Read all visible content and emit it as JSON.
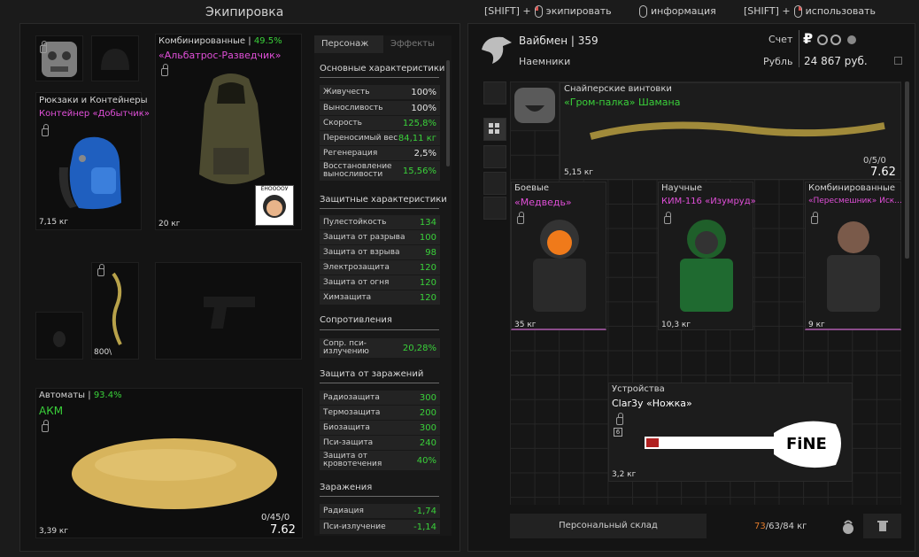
{
  "window": {
    "title": "Экипировка"
  },
  "hints": [
    {
      "prefix": "[SHIFT] +",
      "mouse": "left",
      "label": "экипировать"
    },
    {
      "prefix": "",
      "mouse": "none",
      "label": "информация"
    },
    {
      "prefix": "[SHIFT] +",
      "mouse": "right",
      "label": "использовать"
    }
  ],
  "equip": {
    "backpack": {
      "category": "Рюкзаки и Контейнеры",
      "name": "Контейнер «Добытчик»",
      "weight": "7,15 кг"
    },
    "armor": {
      "category": "Комбинированные",
      "pct": "49.5%",
      "name": "«Альбатрос-Разведчик»",
      "weight": "20 кг",
      "badge": "ЁНООООУ"
    },
    "artifact": {
      "weight": "800\\"
    },
    "rifle": {
      "category": "Автоматы",
      "pct": "93.4%",
      "name": "АКМ",
      "weight": "3,39 кг",
      "ammo": "0/45/0",
      "caliber": "7.62"
    }
  },
  "stats": {
    "tabs": [
      "Персонаж",
      "Эффекты"
    ],
    "sections": [
      {
        "title": "Основные характеристики",
        "rows": [
          {
            "k": "Живучесть",
            "v": "100%",
            "c": "w"
          },
          {
            "k": "Выносливость",
            "v": "100%",
            "c": "w"
          },
          {
            "k": "Скорость",
            "v": "125,8%",
            "c": "g"
          },
          {
            "k": "Переносимый вес",
            "v": "84,11 кг",
            "c": "g"
          },
          {
            "k": "Регенерация",
            "v": "2,5%",
            "c": "w"
          },
          {
            "k": "Восстановление выносливости",
            "v": "15,56%",
            "c": "g"
          }
        ]
      },
      {
        "title": "Защитные характеристики",
        "rows": [
          {
            "k": "Пулестойкость",
            "v": "134",
            "c": "g"
          },
          {
            "k": "Защита от разрыва",
            "v": "100",
            "c": "g"
          },
          {
            "k": "Защита от взрыва",
            "v": "98",
            "c": "g"
          },
          {
            "k": "Электрозащита",
            "v": "120",
            "c": "g"
          },
          {
            "k": "Защита от огня",
            "v": "120",
            "c": "g"
          },
          {
            "k": "Химзащита",
            "v": "120",
            "c": "g"
          }
        ]
      },
      {
        "title": "Сопротивления",
        "rows": [
          {
            "k": "Сопр. пси-излучению",
            "v": "20,28%",
            "c": "g"
          }
        ]
      },
      {
        "title": "Защита от заражений",
        "rows": [
          {
            "k": "Радиозащита",
            "v": "300",
            "c": "g"
          },
          {
            "k": "Термозащита",
            "v": "200",
            "c": "g"
          },
          {
            "k": "Биозащита",
            "v": "300",
            "c": "g"
          },
          {
            "k": "Пси-защита",
            "v": "240",
            "c": "g"
          },
          {
            "k": "Защита от кровотечения",
            "v": "40%",
            "c": "g"
          }
        ]
      },
      {
        "title": "Заражения",
        "rows": [
          {
            "k": "Радиация",
            "v": "-1,74",
            "c": "g"
          },
          {
            "k": "Пси-излучение",
            "v": "-1,14",
            "c": "g"
          }
        ]
      }
    ]
  },
  "trader": {
    "name": "Вайбмен",
    "level": "359",
    "faction": "Наемники",
    "account_label": "Счет",
    "currency_label": "Рубль",
    "balance": "24 867 руб.",
    "ruble": "₽"
  },
  "items": {
    "sniper": {
      "category": "Снайперские винтовки",
      "name": "«Гром-палка» Шамана",
      "weight": "5,15 кг",
      "ammo": "0/5/0",
      "caliber": "7.62"
    },
    "combat": {
      "category": "Боевые",
      "name": "«Медведь»",
      "weight": "35 кг"
    },
    "science": {
      "category": "Научные",
      "name": "КИМ-116 «Изумруд»",
      "weight": "10,3 кг"
    },
    "combined": {
      "category": "Комбинированные",
      "name": "«Пересмешник» Иск...",
      "weight": "9 кг"
    },
    "device": {
      "category": "Устройства",
      "name": "Clar3y «Ножка»",
      "weight": "3,2 кг",
      "level": "6",
      "text": "FiNE"
    }
  },
  "footer": {
    "stash": "Персональный склад",
    "weight_used": "73",
    "weight_mid": "63",
    "weight_max": "84 кг"
  }
}
